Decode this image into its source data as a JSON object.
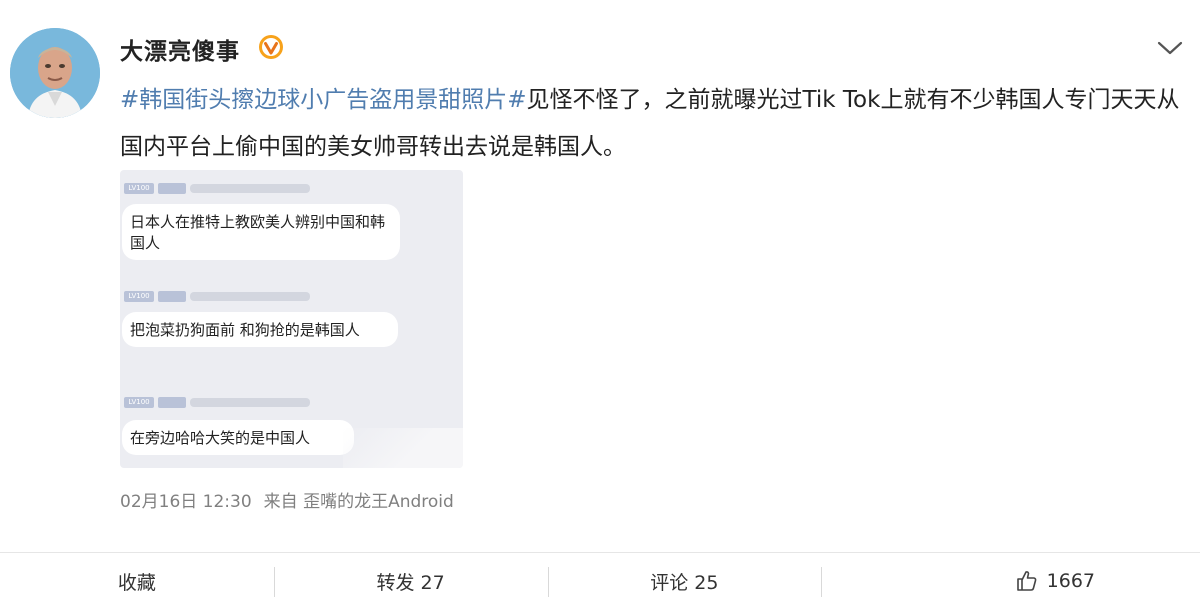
{
  "post": {
    "username": "大漂亮傻事",
    "hashtag": "#韩国街头擦边球小广告盗用景甜照片#",
    "body_text": "见怪不怪了，之前就曝光过Tik Tok上就有不少韩国人专门天天从国内平台上偷中国的美女帅哥转出去说是韩国人。",
    "embedded_screenshot": {
      "messages": [
        {
          "badge": "LV100",
          "text": "日本人在推特上教欧美人辨别中国和韩国人"
        },
        {
          "badge": "LV100",
          "text": "把泡菜扔狗面前 和狗抢的是韩国人"
        },
        {
          "badge": "LV100",
          "text": "在旁边哈哈大笑的是中国人"
        }
      ]
    },
    "date": "02月16日 12:30",
    "source": "来自 歪嘴的龙王Android"
  },
  "actions": {
    "favorite_label": "收藏",
    "repost_label": "转发 27",
    "comment_label": "评论 25",
    "like_count": "1667"
  },
  "colors": {
    "hashtag": "#507daf",
    "verified_badge": "#f7a21b",
    "meta_text": "#808080"
  },
  "icons": {
    "verified": "verified-badge-icon",
    "menu": "chevron-down-icon",
    "like": "thumbs-up-icon"
  }
}
